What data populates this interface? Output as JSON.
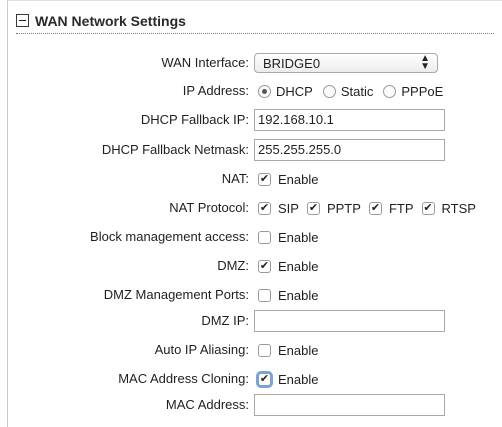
{
  "section": {
    "title": "WAN Network Settings"
  },
  "wan_interface": {
    "label": "WAN Interface:",
    "value": "BRIDGE0"
  },
  "ip_address": {
    "label": "IP Address:",
    "options": [
      "DHCP",
      "Static",
      "PPPoE"
    ],
    "selected": "DHCP"
  },
  "dhcp_fallback_ip": {
    "label": "DHCP Fallback IP:",
    "value": "192.168.10.1"
  },
  "dhcp_fallback_netmask": {
    "label": "DHCP Fallback Netmask:",
    "value": "255.255.255.0"
  },
  "nat": {
    "label": "NAT:",
    "option": "Enable",
    "checked": true
  },
  "nat_protocol": {
    "label": "NAT Protocol:",
    "options": [
      {
        "name": "SIP",
        "checked": true
      },
      {
        "name": "PPTP",
        "checked": true
      },
      {
        "name": "FTP",
        "checked": true
      },
      {
        "name": "RTSP",
        "checked": true
      }
    ]
  },
  "block_management_access": {
    "label": "Block management access:",
    "option": "Enable",
    "checked": false
  },
  "dmz": {
    "label": "DMZ:",
    "option": "Enable",
    "checked": true
  },
  "dmz_management_ports": {
    "label": "DMZ Management Ports:",
    "option": "Enable",
    "checked": false
  },
  "dmz_ip": {
    "label": "DMZ IP:",
    "value": ""
  },
  "auto_ip_aliasing": {
    "label": "Auto IP Aliasing:",
    "option": "Enable",
    "checked": false
  },
  "mac_address_cloning": {
    "label": "MAC Address Cloning:",
    "option": "Enable",
    "checked": true
  },
  "mac_address": {
    "label": "MAC Address:",
    "value": ""
  }
}
